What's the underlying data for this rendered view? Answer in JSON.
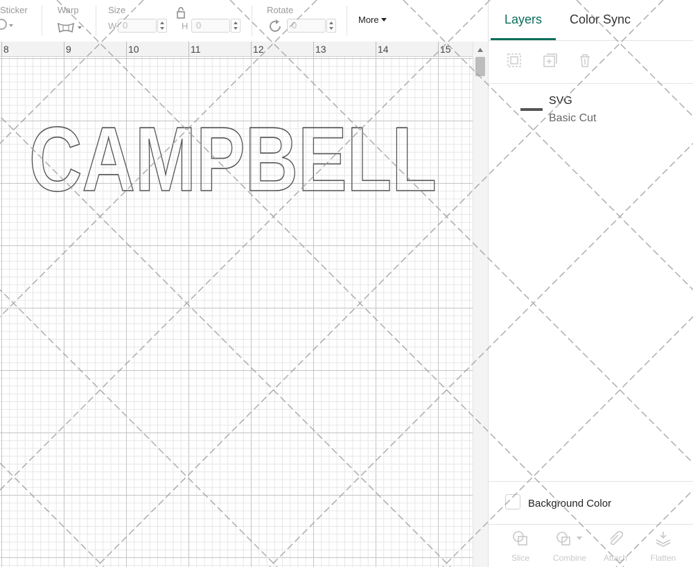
{
  "toolbar": {
    "sticker_label": "Sticker",
    "warp_label": "Warp",
    "size_label": "Size",
    "width_letter": "W",
    "width_value": "0",
    "height_letter": "H",
    "height_value": "0",
    "rotate_label": "Rotate",
    "rotate_value": "0",
    "more_label": "More"
  },
  "ruler": {
    "numbers": [
      "8",
      "9",
      "10",
      "11",
      "12",
      "13",
      "14",
      "15"
    ]
  },
  "canvas": {
    "text": "CAMPBELL"
  },
  "panel": {
    "tabs": [
      {
        "label": "Layers",
        "active": true
      },
      {
        "label": "Color Sync",
        "active": false
      }
    ],
    "layer": {
      "name": "SVG",
      "type": "Basic Cut"
    },
    "background_color_label": "Background Color",
    "bottom_tools": [
      "Slice",
      "Combine",
      "Attach",
      "Flatten"
    ]
  },
  "colors": {
    "accent": "#0b6e5c",
    "disabled": "#c8c8c8"
  }
}
